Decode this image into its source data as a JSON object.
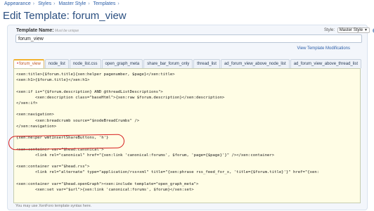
{
  "breadcrumb": [
    "Appearance",
    "Styles",
    "Master Style",
    "Templates"
  ],
  "page_title": "Edit Template: forum_view",
  "template_name": {
    "label": "Template Name:",
    "hint": "Must be unique",
    "value": "forum_view"
  },
  "style": {
    "label": "Style:",
    "selected": "Master Style",
    "help": "?"
  },
  "view_modifications_link": "View Template Modifications",
  "tabs": [
    "forum_view",
    "node_list",
    "node_list.css",
    "open_graph_meta",
    "share_bar_forum_only",
    "thread_list",
    "ad_forum_view_above_node_list",
    "ad_forum_view_above_thread_list"
  ],
  "active_tab": "forum_view",
  "code": "<xen:title>{$forum.title}{xen:helper pagenumber, $page}</xen:title>\n<xen:h1>{$forum.title}</xen:h1>\n\n<xen:if is=\"{$forum.description} AND @threadListDescriptions\">\n        <xen:description class=\"baseHtml\">{xen:raw $forum.description}</xen:description>\n</xen:if>\n\n<xen:navigation>\n        <xen:breadcrumb source=\"$nodeBreadCrumbs\" />\n</xen:navigation>\n\n{xen:helper wmtInsertShareButtons, 'h'}\n\n<xen:container var=\"$head.canonical\">\n        <link rel=\"canonical\" href=\"{xen:link 'canonical:forums', $forum, 'page={$page}'}\" /></xen:container>\n\n<xen:container var=\"$head.rss\">\n        <link rel=\"alternate\" type=\"application/rss+xml\" title=\"{xen:phrase rss_feed_for_x, 'title={$forum.title}'}\" href=\"{xen:\n\n<xen:container var=\"$head.openGraph\"><xen:include template=\"open_graph_meta\">\n        <xen:set var=\"$url\">{xen:link 'canonical:forums', $forum}</xen:set>",
  "footer_note": "You may use XenForo template syntax here.",
  "colors": {
    "link": "#2b5ea8",
    "title": "#2b4f80",
    "editor_bg": "#fffde5",
    "annotation_ring": "#d61e1e",
    "active_tab_accent": "#f2b330"
  }
}
